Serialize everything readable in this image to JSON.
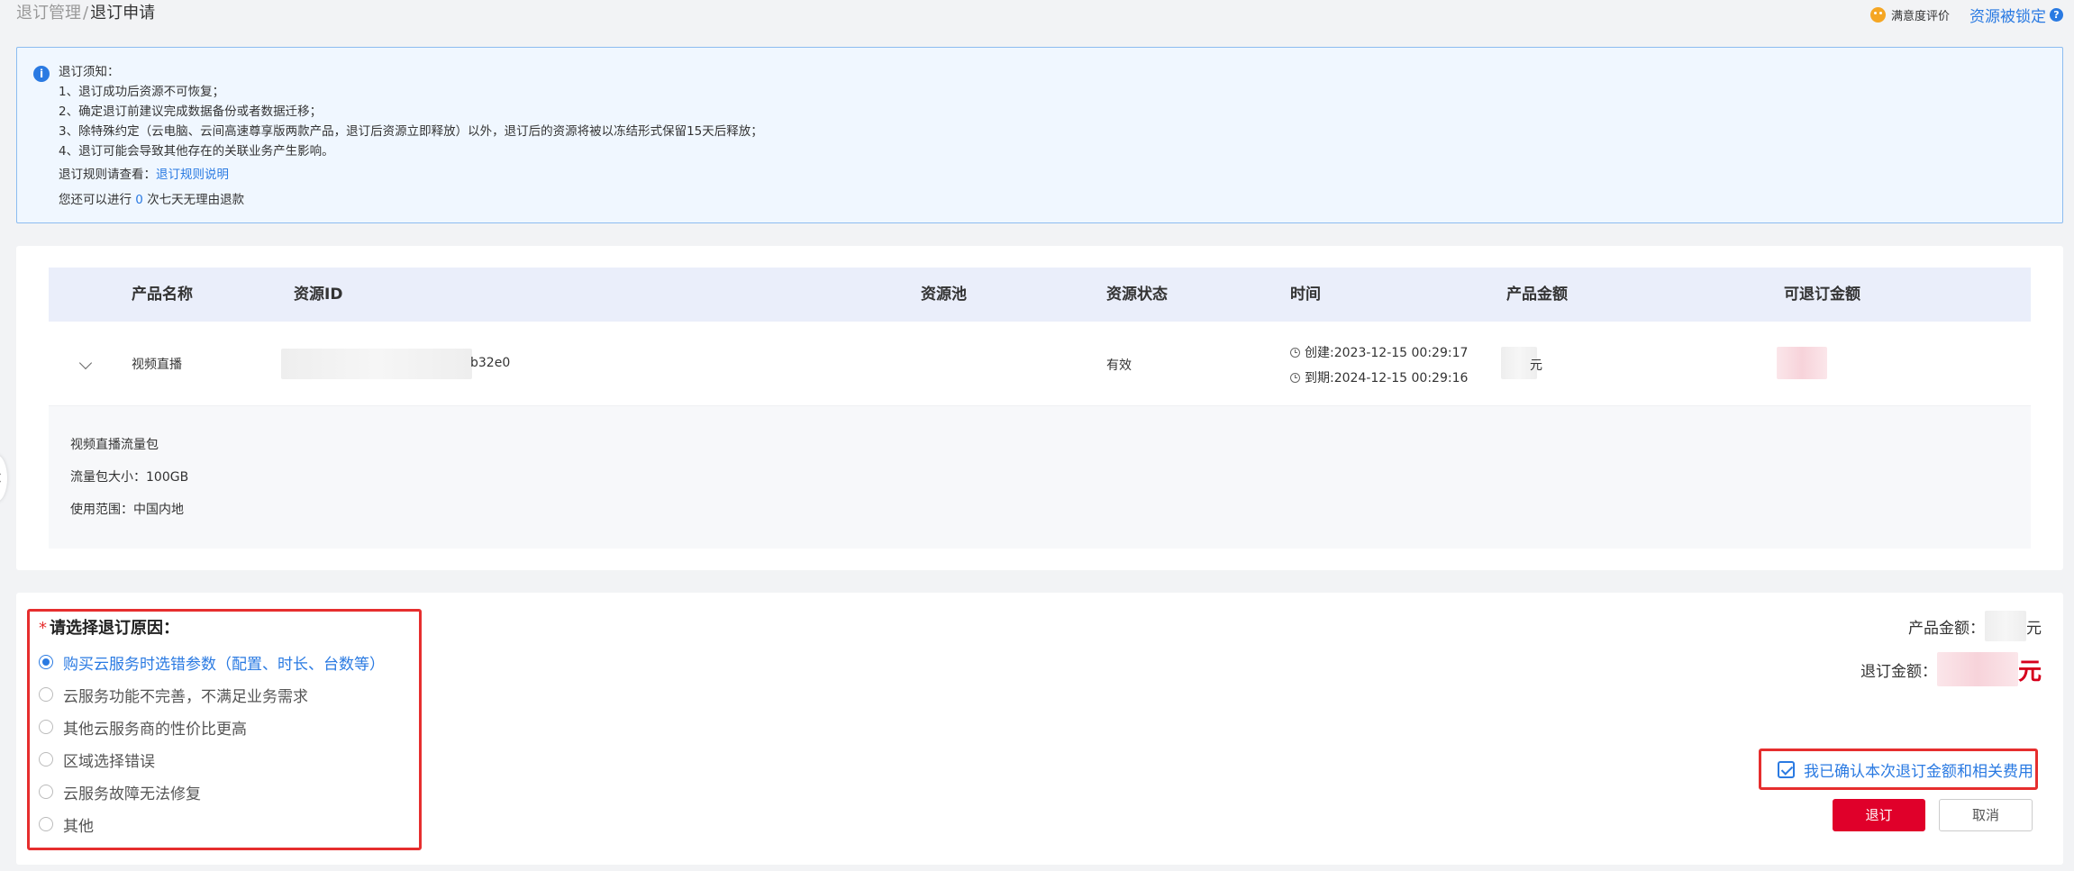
{
  "breadcrumb": {
    "parent": "退订管理",
    "separator": "/",
    "current": "退订申请"
  },
  "top_right": {
    "satisfaction": "满意度评价",
    "resource_locked": "资源被锁定"
  },
  "notice": {
    "title": "退订须知：",
    "items": [
      "1、退订成功后资源不可恢复；",
      "2、确定退订前建议完成数据备份或者数据迁移；",
      "3、除特殊约定（云电脑、云间高速尊享版两款产品，退订后资源立即释放）以外，退订后的资源将被以冻结形式保留15天后释放；",
      "4、退订可能会导致其他存在的关联业务产生影响。"
    ],
    "rules_prefix": "退订规则请查看：",
    "rules_link": "退订规则说明",
    "refund_prefix": "您还可以进行",
    "refund_count": "0",
    "refund_suffix": "次七天无理由退款"
  },
  "table": {
    "headers": {
      "product_name": "产品名称",
      "resource_id": "资源ID",
      "resource_pool": "资源池",
      "status": "资源状态",
      "time": "时间",
      "amount": "产品金额",
      "refundable": "可退订金额"
    },
    "row": {
      "product_name": "视频直播",
      "resource_id_suffix": "b32e0",
      "status": "有效",
      "created": "创建:2023-12-15 00:29:17",
      "expires": "到期:2024-12-15 00:29:16",
      "amount_unit": "元"
    },
    "detail": {
      "package_name": "视频直播流量包",
      "size": "流量包大小：100GB",
      "scope": "使用范围：中国内地"
    }
  },
  "reason": {
    "required_mark": "*",
    "title": "请选择退订原因：",
    "options": [
      "购买云服务时选错参数（配置、时长、台数等）",
      "云服务功能不完善，不满足业务需求",
      "其他云服务商的性价比更高",
      "区域选择错误",
      "云服务故障无法修复",
      "其他"
    ],
    "selected_index": 0
  },
  "summary": {
    "product_amount_label": "产品金额：",
    "unit": "元",
    "refund_amount_label": "退订金额：",
    "confirm_text": "我已确认本次退订金额和相关费用",
    "confirm_checked": true,
    "submit_label": "退订",
    "cancel_label": "取消"
  },
  "colors": {
    "accent": "#2a7ae2",
    "danger": "#e0002a",
    "highlight_border": "#e62e2e"
  }
}
